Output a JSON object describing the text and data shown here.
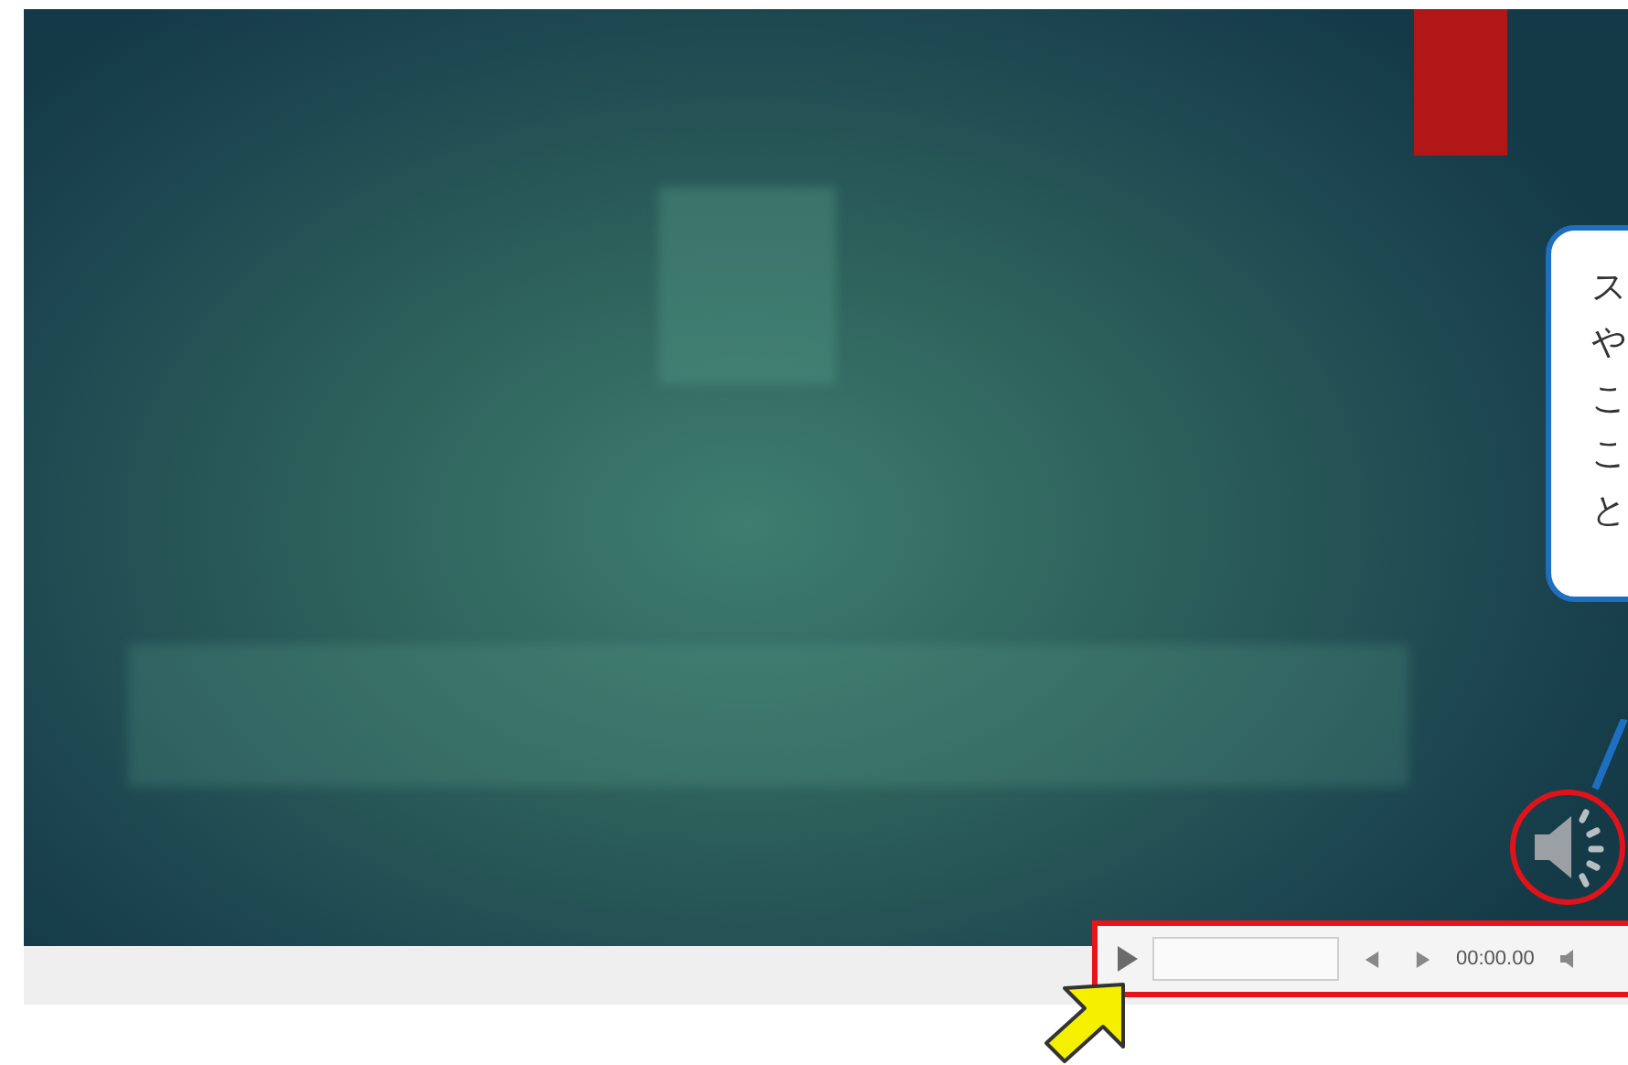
{
  "slide": {
    "callout": {
      "text": "スやここと"
    }
  },
  "player": {
    "time": "00:00.00"
  }
}
